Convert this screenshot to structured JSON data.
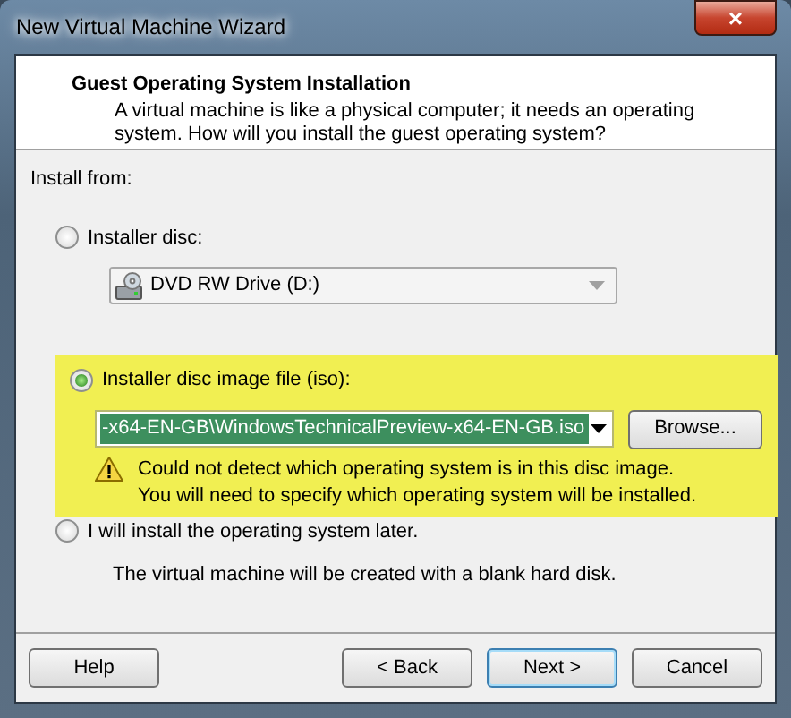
{
  "window": {
    "title": "New Virtual Machine Wizard",
    "close": "×"
  },
  "header": {
    "title": "Guest Operating System Installation",
    "description": "A virtual machine is like a physical computer; it needs an operating system. How will you install the guest operating system?"
  },
  "install_from": "Install from:",
  "options": [
    {
      "kind": "disc",
      "label": "Installer disc:",
      "selected": false,
      "drive": "DVD RW Drive (D:)",
      "disabled": true
    },
    {
      "kind": "image",
      "label": "Installer disc image file (iso):",
      "selected": true,
      "highlighted": true,
      "path": "-x64-EN-GB\\WindowsTechnicalPreview-x64-EN-GB.iso",
      "browse": "Browse...",
      "warning": [
        "Could not detect which operating system is in this disc image.",
        "You will need to specify which operating system will be installed."
      ]
    },
    {
      "kind": "later",
      "label": "I will install the operating system later.",
      "selected": false,
      "note": "The virtual machine will be created with a blank hard disk."
    }
  ],
  "buttons": [
    {
      "label": "Help",
      "default": false
    },
    {
      "label": "< Back",
      "default": false
    },
    {
      "label": "Next >",
      "default": true
    },
    {
      "label": "Cancel",
      "default": false
    }
  ]
}
